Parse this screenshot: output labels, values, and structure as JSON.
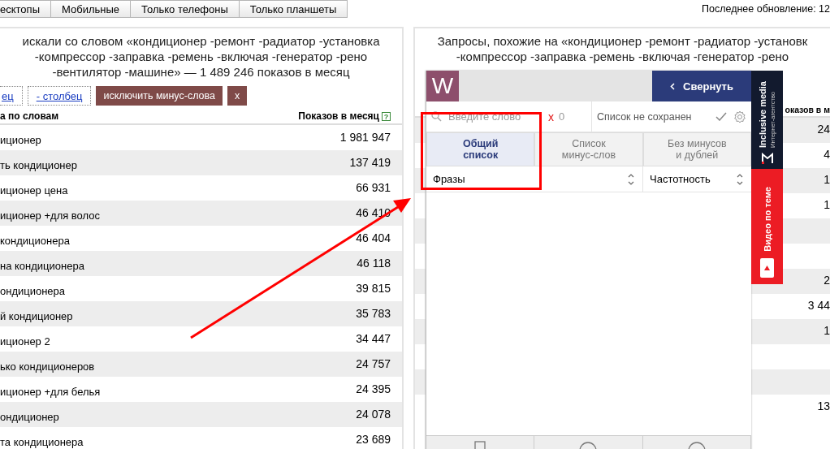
{
  "device_filter": {
    "options": [
      {
        "label": "есктопы"
      },
      {
        "label": "Мобильные"
      },
      {
        "label": "Только телефоны"
      },
      {
        "label": "Только планшеты"
      }
    ]
  },
  "last_update": "Последнее обновление: 12",
  "left_panel": {
    "heading": [
      "искали со словом «кондиционер -ремонт -радиатор -установка",
      "-компрессор -заправка -ремень -включая -генератор -рено",
      "-вентилятор -машине» — 1 489 246 показов в месяц"
    ],
    "actions": [
      {
        "kind": "link",
        "label": "ец"
      },
      {
        "kind": "link",
        "label": "- столбец"
      },
      {
        "kind": "button",
        "label": "исключить минус-слова"
      },
      {
        "kind": "button",
        "label": "x"
      }
    ],
    "columns": [
      "а по словам",
      "Показов в месяц"
    ],
    "help_mark": "?",
    "rows": [
      {
        "phrase": "иционер",
        "count": "1 981 947"
      },
      {
        "phrase": "ть кондиционер",
        "count": "137 419"
      },
      {
        "phrase": "иционер цена",
        "count": "66 931"
      },
      {
        "phrase": "иционер +для волос",
        "count": "46 410"
      },
      {
        "phrase": "кондиционера",
        "count": "46 404"
      },
      {
        "phrase": "на кондиционера",
        "count": "46 118"
      },
      {
        "phrase": "ондиционера",
        "count": "39 815"
      },
      {
        "phrase": "й кондиционер",
        "count": "35 783"
      },
      {
        "phrase": "иционер 2",
        "count": "34 447"
      },
      {
        "phrase": "ько кондиционеров",
        "count": "24 757"
      },
      {
        "phrase": "иционер +для белья",
        "count": "24 395"
      },
      {
        "phrase": "ондиционер",
        "count": "24 078"
      },
      {
        "phrase": "та кондиционера",
        "count": "23 689"
      }
    ]
  },
  "right_panel": {
    "heading": [
      "Запросы, похожие на «кондиционер -ремонт -радиатор -установк",
      "-компрессор -заправка -ремень -включая -генератор -рено"
    ],
    "column_header": "оказов в м",
    "rows": [
      {
        "count": "24"
      },
      {
        "count": "4"
      },
      {
        "count": "1"
      },
      {
        "count": "1"
      },
      {},
      {},
      {
        "count": "2"
      },
      {
        "count": "3 44"
      },
      {
        "count": "1"
      },
      {},
      {},
      {
        "count": "13"
      }
    ]
  },
  "extension": {
    "logo": "W",
    "collapse_button": "Свернуть",
    "search": {
      "placeholder": "Введите слово"
    },
    "clear": "x",
    "count": "0",
    "list_status": "Список не сохранен",
    "tabs": [
      {
        "label": "Общий список",
        "selected": true
      },
      {
        "label": "Список минус-слов",
        "selected": false
      },
      {
        "label": "Без минусов и дублей",
        "selected": false
      }
    ],
    "columns": [
      "Фразы",
      "Частотность"
    ]
  },
  "ad_strip": {
    "agency_caption": "Интернет-агентство",
    "agency_name": "Inclusive media",
    "video_label": "Видео по теме"
  }
}
